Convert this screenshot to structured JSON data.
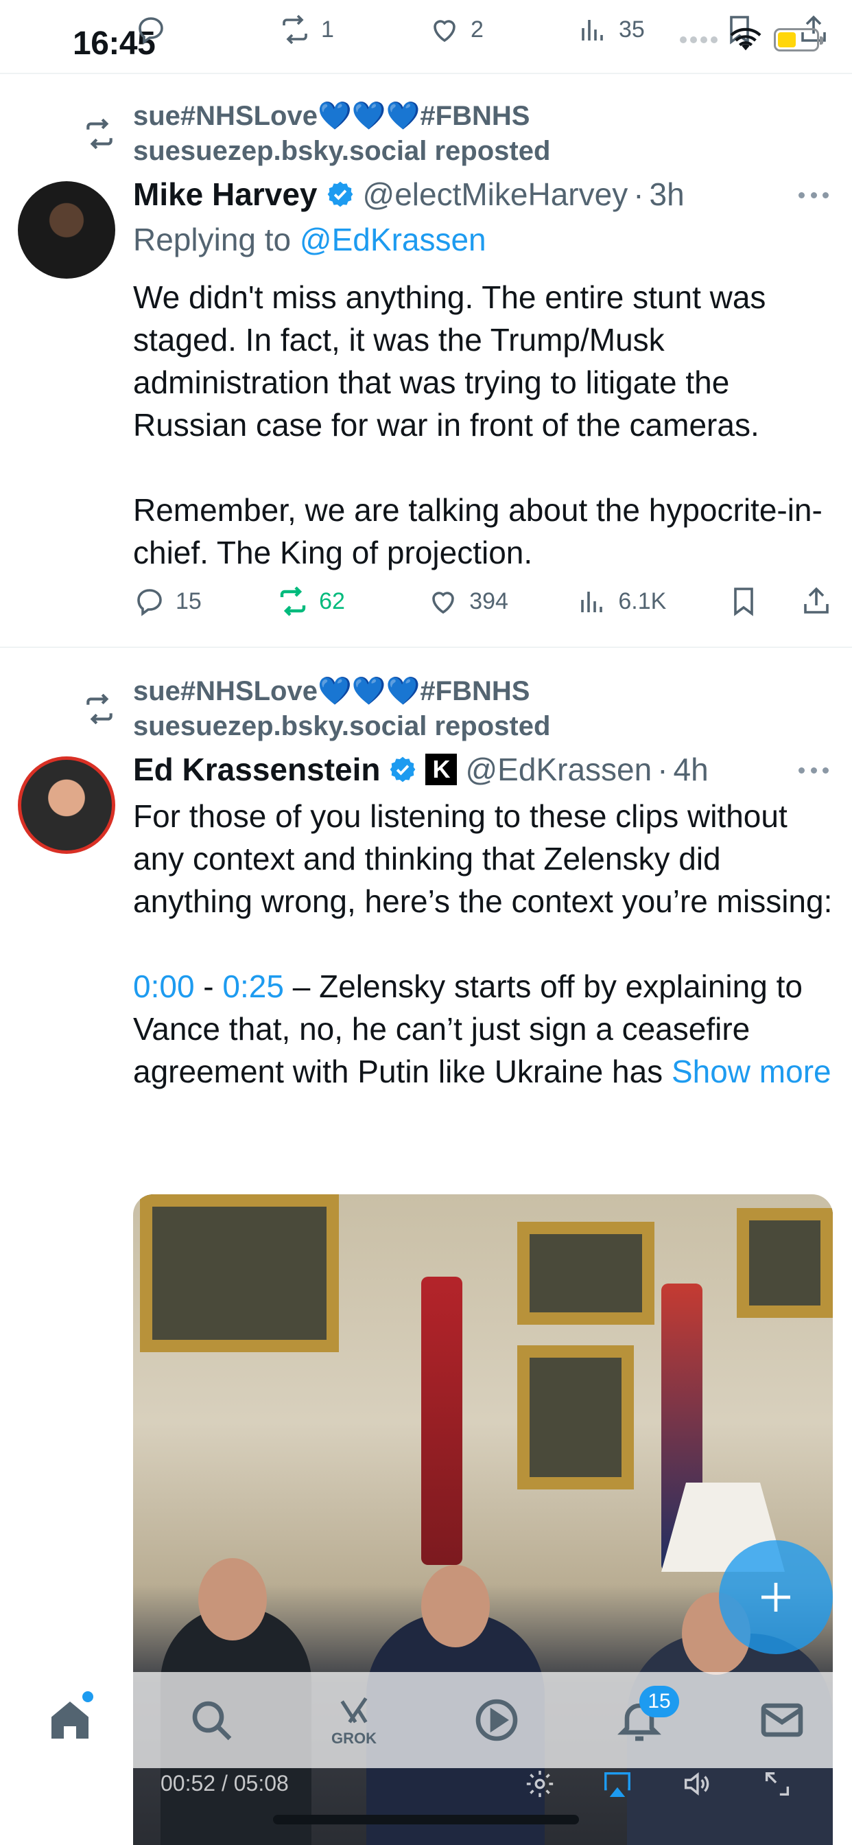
{
  "status_bar": {
    "time": "16:45"
  },
  "top_actions": {
    "replies": "",
    "reposts": "1",
    "likes": "2",
    "views": "35"
  },
  "posts": [
    {
      "repost_by_name": "sue#NHSLove💙💙💙#FBNHS",
      "repost_by_line": "suesuezep.bsky.social reposted",
      "author_name": "Mike Harvey",
      "author_handle": "@electMikeHarvey",
      "time": "3h",
      "replying_prefix": "Replying to",
      "replying_to": "@EdKrassen",
      "paragraph1": "We didn't miss anything. The entire stunt was staged. In fact, it was the Trump/Musk administration that was trying to litigate the Russian case for war in front of the cameras.",
      "paragraph2": "Remember, we are talking about the hypocrite-in-chief. The King of projection.",
      "replies": "15",
      "reposts": "62",
      "likes": "394",
      "views": "6.1K"
    },
    {
      "repost_by_name": "sue#NHSLove💙💙💙#FBNHS",
      "repost_by_line": "suesuezep.bsky.social reposted",
      "author_name": "Ed Krassenstein",
      "author_handle": "@EdKrassen",
      "time": "4h",
      "paragraph1": "For those of you listening to these clips without any context and thinking that Zelensky did anything wrong, here’s the context you’re missing:",
      "timestamp_start": "0:00",
      "timestamp_sep": " - ",
      "timestamp_end": "0:25",
      "paragraph2_rest": " – Zelensky starts off by explaining to Vance that, no, he can’t just sign a ceasefire agreement with Putin like Ukraine has ",
      "show_more": "Show more",
      "video_time": "00:52 / 05:08"
    }
  ],
  "tabbar": {
    "grok_label": "GROK",
    "notifications_badge": "15"
  },
  "colors": {
    "accent": "#1d9bf0",
    "repost_green": "#00ba7c",
    "muted": "#536471"
  }
}
